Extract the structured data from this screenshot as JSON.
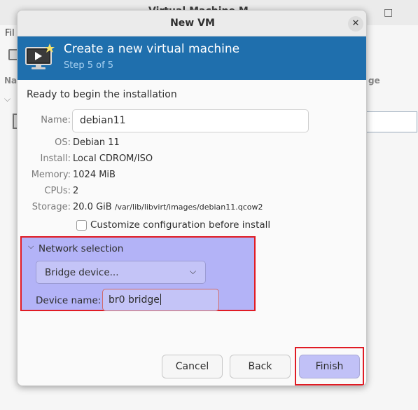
{
  "background": {
    "window_title": "Virtual Machine Manager",
    "window_title_visible": "Virtual Machine M",
    "minimize_glyph": "□",
    "menu_file": "Fil",
    "column_name": "Na",
    "column_usage": "ge",
    "chevron": "⌵"
  },
  "dialog": {
    "title": "New VM",
    "close_glyph": "✕",
    "banner": {
      "title": "Create a new virtual machine",
      "step": "Step 5 of 5",
      "icon": "vm-monitor-star-icon"
    },
    "ready_text": "Ready to begin the installation",
    "fields": {
      "name_label": "Name:",
      "name_value": "debian11",
      "os_label": "OS:",
      "os_value": "Debian 11",
      "install_label": "Install:",
      "install_value": "Local CDROM/ISO",
      "memory_label": "Memory:",
      "memory_value": "1024 MiB",
      "cpus_label": "CPUs:",
      "cpus_value": "2",
      "storage_label": "Storage:",
      "storage_size": "20.0 GiB",
      "storage_path": "/var/lib/libvirt/images/debian11.qcow2"
    },
    "customize_label": "Customize configuration before install",
    "customize_checked": false,
    "network": {
      "expander_glyph": "⌵",
      "title": "Network selection",
      "dropdown_value": "Bridge device...",
      "dropdown_arrow": "⌵",
      "device_label": "Device name:",
      "device_value": "br0 bridge"
    },
    "buttons": {
      "cancel": "Cancel",
      "back": "Back",
      "finish": "Finish"
    }
  },
  "colors": {
    "banner": "#1f6fad",
    "highlight_fill": "#b3b3f7",
    "highlight_border": "#e01b24"
  }
}
